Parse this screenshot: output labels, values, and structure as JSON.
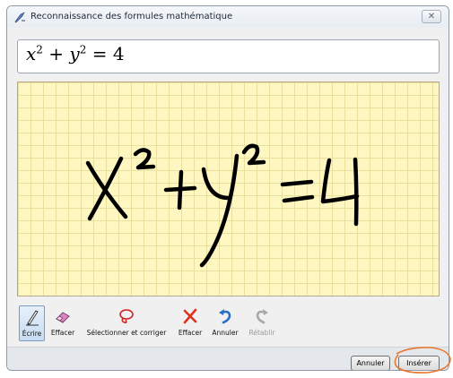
{
  "window": {
    "title": "Reconnaissance des formules mathématique",
    "close_symbol": "✕"
  },
  "formula": {
    "var_x": "x",
    "exp_x": "2",
    "plus": " + ",
    "var_y": "y",
    "exp_y": "2",
    "equals": " = ",
    "rhs": "4"
  },
  "ink_area": {
    "background_color": "#fff7c2",
    "grid_color": "#e9df9f",
    "ink_color": "#000000"
  },
  "toolbar": {
    "tools": [
      {
        "label": "Écrire",
        "icon": "pen-icon",
        "state": "active"
      },
      {
        "label": "Effacer",
        "icon": "eraser-icon",
        "state": "normal"
      },
      {
        "label": "Sélectionner et corriger",
        "icon": "lasso-icon",
        "state": "normal"
      },
      {
        "label": "Effacer",
        "icon": "clear-icon",
        "state": "normal"
      },
      {
        "label": "Annuler",
        "icon": "undo-icon",
        "state": "normal"
      },
      {
        "label": "Rétablir",
        "icon": "redo-icon",
        "state": "disabled"
      }
    ]
  },
  "buttons": {
    "cancel": "Annuler",
    "insert": "Insérer"
  },
  "annotation": {
    "highlight_color": "#e87830"
  }
}
